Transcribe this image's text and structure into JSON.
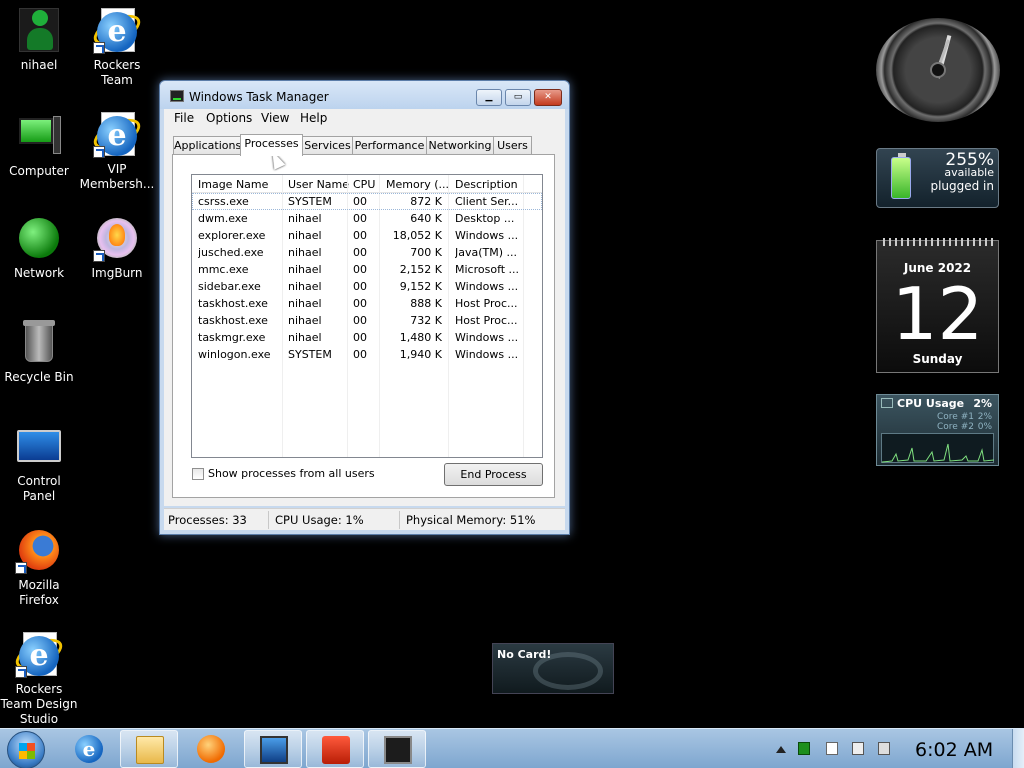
{
  "desktop": {
    "icons": [
      {
        "label": "nihael",
        "icon": "user-folder-icon"
      },
      {
        "label": "Rockers Team",
        "icon": "internet-explorer-icon"
      },
      {
        "label": "Computer",
        "icon": "computer-icon"
      },
      {
        "label": "VIP Membersh...",
        "icon": "internet-explorer-icon"
      },
      {
        "label": "Network",
        "icon": "network-icon"
      },
      {
        "label": "ImgBurn",
        "icon": "imgburn-icon"
      },
      {
        "label": "Recycle Bin",
        "icon": "recycle-bin-icon"
      },
      {
        "label": "Control Panel",
        "icon": "control-panel-icon"
      },
      {
        "label": "Mozilla Firefox",
        "icon": "firefox-icon"
      },
      {
        "label": "Rockers Team Design Studio",
        "icon": "internet-explorer-icon"
      }
    ]
  },
  "taskmgr": {
    "title": "Windows Task Manager",
    "buttons": {
      "minimize": "▁",
      "maximize": "▭",
      "close": "✕"
    },
    "menu": [
      "File",
      "Options",
      "View",
      "Help"
    ],
    "tabs": [
      "Applications",
      "Processes",
      "Services",
      "Performance",
      "Networking",
      "Users"
    ],
    "active_tab": "Processes",
    "columns": [
      "Image Name",
      "User Name",
      "CPU",
      "Memory (...",
      "Description"
    ],
    "rows": [
      {
        "image": "csrss.exe",
        "user": "SYSTEM",
        "cpu": "00",
        "mem": "872 K",
        "desc": "Client Ser..."
      },
      {
        "image": "dwm.exe",
        "user": "nihael",
        "cpu": "00",
        "mem": "640 K",
        "desc": "Desktop ..."
      },
      {
        "image": "explorer.exe",
        "user": "nihael",
        "cpu": "00",
        "mem": "18,052 K",
        "desc": "Windows ..."
      },
      {
        "image": "jusched.exe",
        "user": "nihael",
        "cpu": "00",
        "mem": "700 K",
        "desc": "Java(TM) ..."
      },
      {
        "image": "mmc.exe",
        "user": "nihael",
        "cpu": "00",
        "mem": "2,152 K",
        "desc": "Microsoft ..."
      },
      {
        "image": "sidebar.exe",
        "user": "nihael",
        "cpu": "00",
        "mem": "9,152 K",
        "desc": "Windows ..."
      },
      {
        "image": "taskhost.exe",
        "user": "nihael",
        "cpu": "00",
        "mem": "888 K",
        "desc": "Host Proc..."
      },
      {
        "image": "taskhost.exe",
        "user": "nihael",
        "cpu": "00",
        "mem": "732 K",
        "desc": "Host Proc..."
      },
      {
        "image": "taskmgr.exe",
        "user": "nihael",
        "cpu": "00",
        "mem": "1,480 K",
        "desc": "Windows ..."
      },
      {
        "image": "winlogon.exe",
        "user": "SYSTEM",
        "cpu": "00",
        "mem": "1,940 K",
        "desc": "Windows ..."
      }
    ],
    "show_all_label": "Show processes from all users",
    "show_all_checked": false,
    "end_process_label": "End Process",
    "status": {
      "processes": "Processes: 33",
      "cpu": "CPU Usage: 1%",
      "memory": "Physical Memory: 51%"
    }
  },
  "gadgets": {
    "battery": {
      "percent": "255%",
      "available": "available",
      "state": "plugged in",
      "color": "#39b52a"
    },
    "calendar": {
      "month": "June 2022",
      "day": "12",
      "weekday": "Sunday"
    },
    "cpu": {
      "title": "CPU Usage",
      "total": "2%",
      "core1_label": "Core #1",
      "core1": "2%",
      "core2_label": "Core #2",
      "core2": "0%"
    },
    "card": {
      "text": "No Card!"
    }
  },
  "taskbar": {
    "pinned": [
      "internet-explorer-icon",
      "explorer-folder-icon",
      "media-player-icon",
      "remote-desktop-icon",
      "toolbox-icon",
      "task-manager-icon"
    ],
    "running": [
      "explorer-folder-icon",
      "remote-desktop-icon",
      "toolbox-icon",
      "task-manager-icon"
    ],
    "tray_icons": [
      "show-hidden-icons-arrow",
      "nvidia-tray-icon",
      "action-center-icon",
      "network-tray-icon",
      "volume-muted-icon"
    ],
    "time": "6:02 AM"
  }
}
